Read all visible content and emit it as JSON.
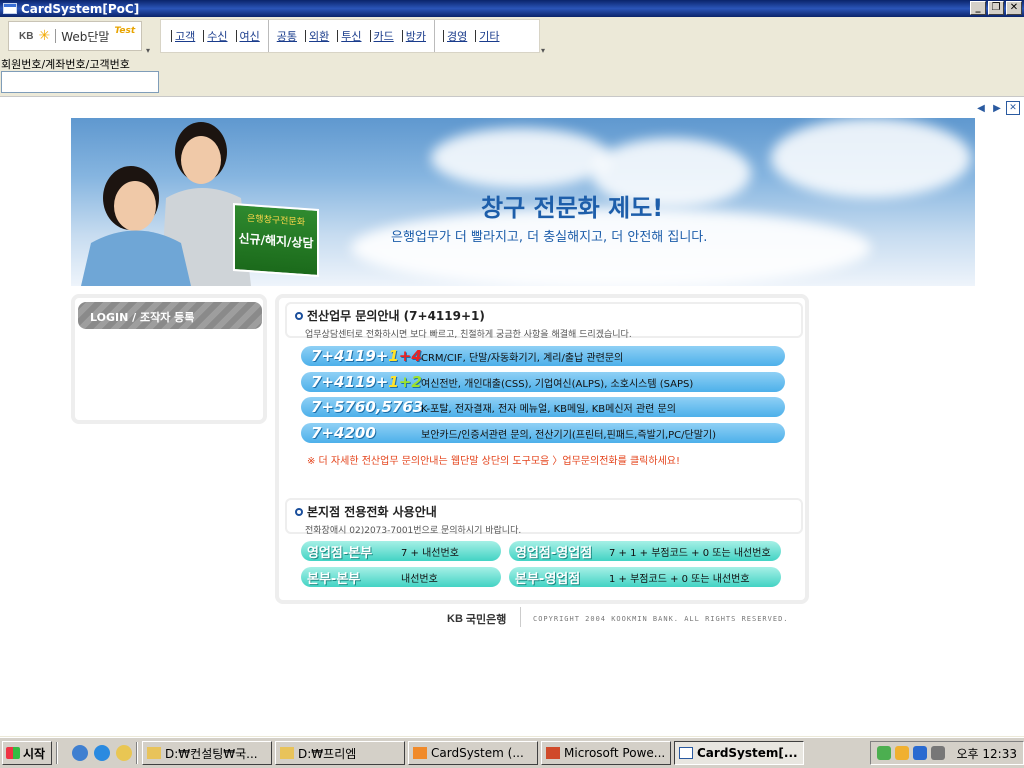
{
  "window": {
    "title": "CardSystem[PoC]",
    "buttons": {
      "minimize": "_",
      "maximize": "❐",
      "close": "✕"
    }
  },
  "toolbar": {
    "brand": {
      "kb": "KB",
      "web": "Web단말",
      "test": "Test"
    },
    "menu": [
      "고객",
      "수신",
      "여신",
      "공통",
      "외환",
      "투신",
      "카드",
      "방카",
      "경영",
      "기타"
    ]
  },
  "search": {
    "label": "회원번호/계좌번호/고객번호",
    "value": ""
  },
  "colors": {
    "accent": "#1d5eaa",
    "phone_row": "#4db0ea",
    "ext_button": "#43d3c4",
    "notice": "#e4431b"
  },
  "banner": {
    "sign_small": "은행창구전문화",
    "sign_big": "신규/해지/상담",
    "title": "창구 전문화 제도!",
    "subtitle": "은행업무가 더 빨라지고, 더 충실해지고, 더 안전해 집니다."
  },
  "login": {
    "tab_label": "LOGIN / 조작자 등록"
  },
  "it_help": {
    "title": "전산업무 문의안내 (7+4119+1)",
    "subtitle": "업무상담센터로 전화하시면 보다 빠르고, 친절하게 궁금한 사항을 해결해 드리겠습니다.",
    "rows": [
      {
        "num_a": "7+4119+",
        "num_b": "1",
        "num_c": "+4",
        "desc": "CRM/CIF, 단말/자동화기기, 계리/출납 관련문의"
      },
      {
        "num_a": "7+4119+",
        "num_b": "1",
        "num_c": "+2",
        "desc": "여신전반, 개인대출(CSS), 기업여신(ALPS), 소호시스템 (SAPS)"
      },
      {
        "num_a": "7+5760,5763",
        "num_b": "",
        "num_c": "",
        "desc": "K-포탈, 전자결재, 전자 메뉴얼, KB메일, KB메신저 관련 문의"
      },
      {
        "num_a": "7+4200",
        "num_b": "",
        "num_c": "",
        "desc": "보안카드/인증서관련 문의, 전산기기(프린터,핀패드,즉발기,PC/단말기)"
      }
    ],
    "notice": "※ 더 자세한 전산업무 문의안내는 웹단말 상단의 도구모음 〉업무문의전화를 클릭하세요!"
  },
  "ext_help": {
    "title": "본지점 전용전화 사용안내",
    "subtitle": "전화장애시 02)2073-7001번으로 문의하시기 바랍니다.",
    "buttons": [
      {
        "label": "영업점-본부",
        "value": "7 + 내선번호"
      },
      {
        "label": "영업점-영업점",
        "value": "7 + 1 + 부점코드 + 0 또는 내선번호"
      },
      {
        "label": "본부-본부",
        "value": "내선번호"
      },
      {
        "label": "본부-영업점",
        "value": "1 + 부점코드 + 0 또는 내선번호"
      }
    ]
  },
  "footer": {
    "bank": "국민은행",
    "kb": "KB",
    "copyright": "COPYRIGHT 2004 KOOKMIN BANK. ALL RIGHTS RESERVED."
  },
  "taskbar": {
    "start": "시작",
    "tasks": [
      "D:₩컨설팅₩국...",
      "D:₩프리엠",
      "CardSystem (...",
      "Microsoft Powe...",
      "CardSystem[..."
    ],
    "clock": "오후 12:33"
  }
}
